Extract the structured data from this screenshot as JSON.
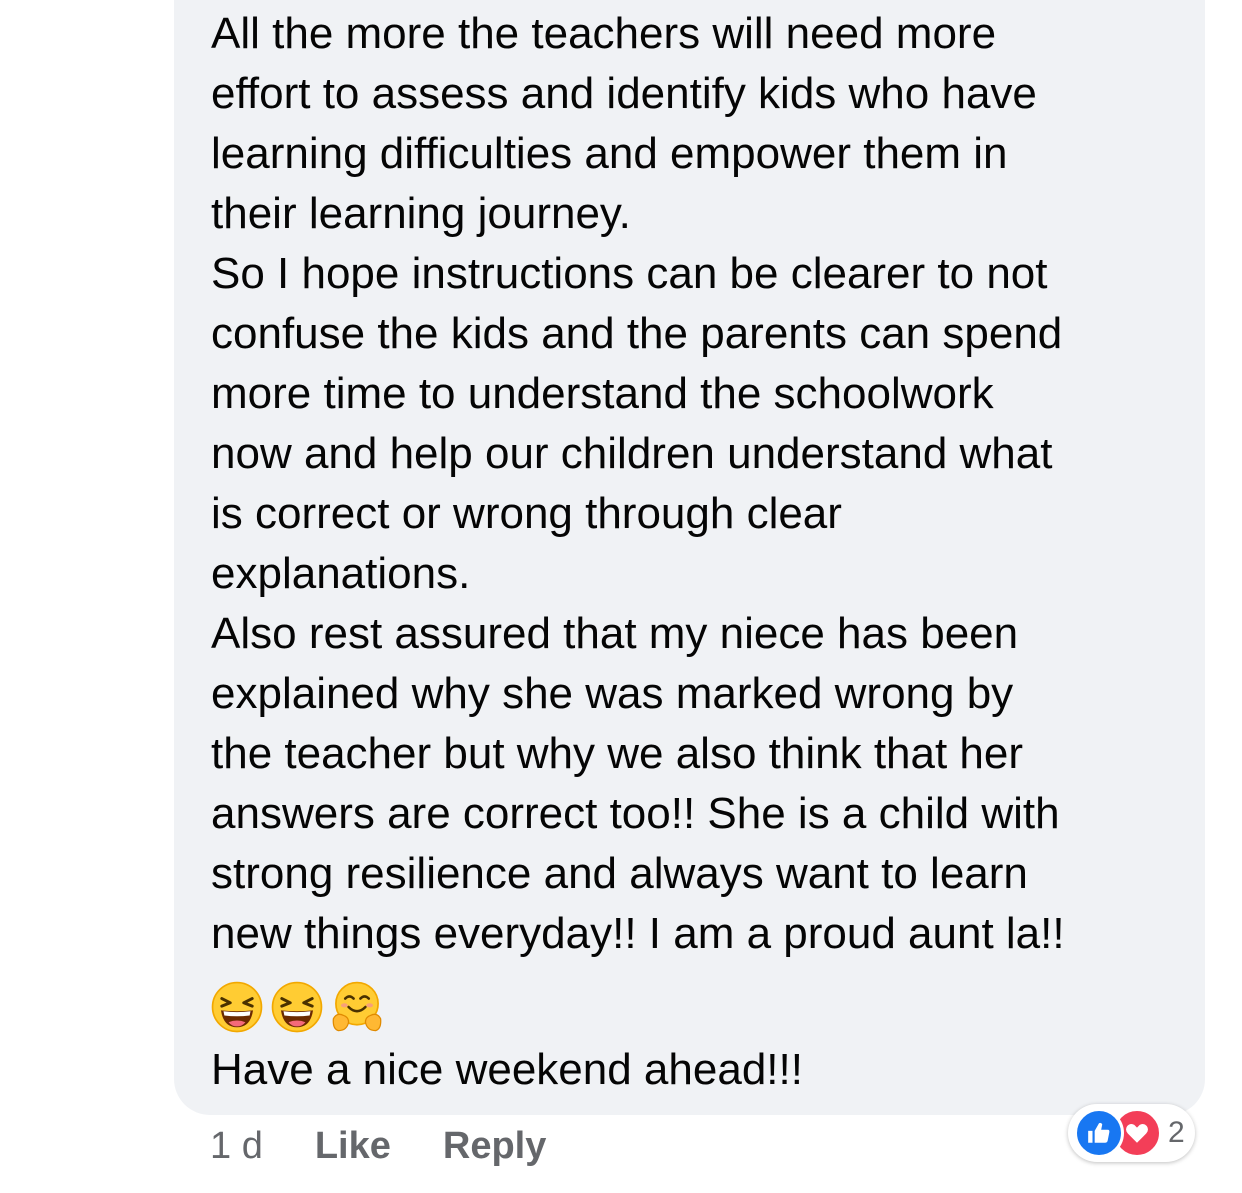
{
  "comment": {
    "paragraphs": [
      "All the more the teachers will need more\neffort to assess and identify kids who have\nlearning difficulties and empower them in\ntheir learning journey.\nSo I hope instructions can be clearer to not\nconfuse the kids and the parents can spend\nmore time to understand the schoolwork\nnow and help our children understand what\nis correct or wrong through clear\nexplanations.\nAlso rest assured that my niece has been\nexplained why she was marked wrong by\nthe teacher but why we also think that her\nanswers are correct too!! She is a child with\nstrong resilience and always want to learn\nnew things everyday!! I am a proud aunt la!!"
    ],
    "emojis": [
      "laughing-face-icon",
      "laughing-face-icon",
      "hugging-face-icon"
    ],
    "closing": "Have a nice weekend ahead!!!"
  },
  "meta": {
    "timestamp": "1 d",
    "like_label": "Like",
    "reply_label": "Reply"
  },
  "reactions": {
    "icons": [
      "like-icon",
      "love-icon"
    ],
    "count": "2"
  },
  "colors": {
    "bubble": "#f0f2f5",
    "text": "#050505",
    "meta": "#65676b",
    "like": "#1877f2",
    "love": "#f33e58"
  }
}
